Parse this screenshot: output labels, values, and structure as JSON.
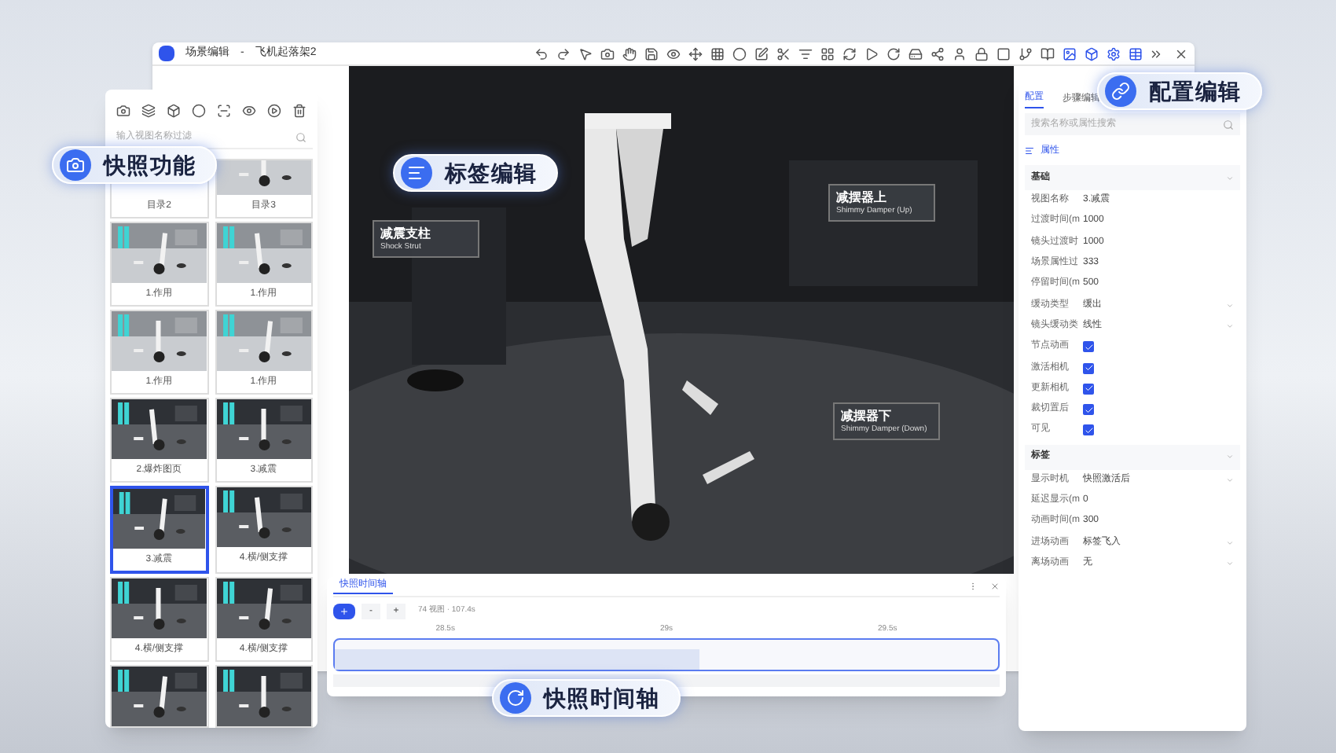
{
  "window": {
    "title": "场景编辑",
    "separator": "-",
    "document": "飞机起落架2"
  },
  "callouts": [
    {
      "kind": "snapshot",
      "text": "快照功能"
    },
    {
      "kind": "label",
      "text": "标签编辑"
    },
    {
      "kind": "config",
      "text": "配置编辑"
    },
    {
      "kind": "timeline",
      "text": "快照时间轴"
    }
  ],
  "scene_labels": [
    {
      "title": "减震支柱",
      "subtitle": "Shock Strut"
    },
    {
      "title": "减摆器上",
      "subtitle": "Shimmy Damper (Up)"
    },
    {
      "title": "减摆器下",
      "subtitle": "Shimmy Damper (Down)"
    }
  ],
  "snapshots": {
    "search": {
      "placeholder": "输入视图名称过滤"
    },
    "items": [
      {
        "label": "目录2",
        "selected": false
      },
      {
        "label": "目录3",
        "selected": false
      },
      {
        "label": "1.作用",
        "selected": false
      },
      {
        "label": "1.作用",
        "selected": false
      },
      {
        "label": "1.作用",
        "selected": false
      },
      {
        "label": "1.作用",
        "selected": false
      },
      {
        "label": "2.爆炸图页",
        "selected": false
      },
      {
        "label": "3.减震",
        "selected": false
      },
      {
        "label": "3.减震",
        "selected": true
      },
      {
        "label": "4.横/侧支撑",
        "selected": false
      },
      {
        "label": "4.横/侧支撑",
        "selected": false
      },
      {
        "label": "4.横/侧支撑",
        "selected": false
      }
    ]
  },
  "config": {
    "tabs": [
      {
        "label": "配置",
        "selected": true
      },
      {
        "label": "步骤编辑",
        "selected": false
      }
    ],
    "search": {
      "placeholder": "搜索名称或属性搜索"
    },
    "section": "属性",
    "groups": [
      {
        "title": "基础",
        "rows": [
          {
            "kind": "text",
            "label": "视图名称",
            "value": "3.减震"
          },
          {
            "kind": "text",
            "label": "过渡时间(m",
            "value": "1000"
          },
          {
            "kind": "text",
            "label": "镜头过渡时",
            "value": "1000"
          },
          {
            "kind": "text",
            "label": "场景属性过",
            "value": "333"
          },
          {
            "kind": "text",
            "label": "停留时间(m",
            "value": "500"
          },
          {
            "kind": "select",
            "label": "缓动类型",
            "value": "缓出"
          },
          {
            "kind": "select",
            "label": "镜头缓动类",
            "value": "线性"
          },
          {
            "kind": "checkbox",
            "label": "节点动画",
            "checked": true
          },
          {
            "kind": "checkbox",
            "label": "激活相机",
            "checked": true
          },
          {
            "kind": "checkbox",
            "label": "更新相机",
            "checked": true
          },
          {
            "kind": "checkbox",
            "label": "裁切置后",
            "checked": true
          },
          {
            "kind": "checkbox",
            "label": "可见",
            "checked": true
          }
        ]
      },
      {
        "title": "标签",
        "rows": [
          {
            "kind": "select",
            "label": "显示时机",
            "value": "快照激活后"
          },
          {
            "kind": "text",
            "label": "延迟显示(m",
            "value": "0"
          },
          {
            "kind": "text",
            "label": "动画时间(m",
            "value": "300"
          },
          {
            "kind": "select",
            "label": "进场动画",
            "value": "标签飞入"
          },
          {
            "kind": "select",
            "label": "离场动画",
            "value": "无"
          }
        ]
      }
    ]
  },
  "timeline": {
    "tab": "快照时间轴",
    "buttons": [
      "-",
      "+"
    ],
    "summary": "74 视图 · 107.4s",
    "ticks": [
      "28.5s",
      "29s",
      "29.5s"
    ],
    "level": 0.55
  }
}
